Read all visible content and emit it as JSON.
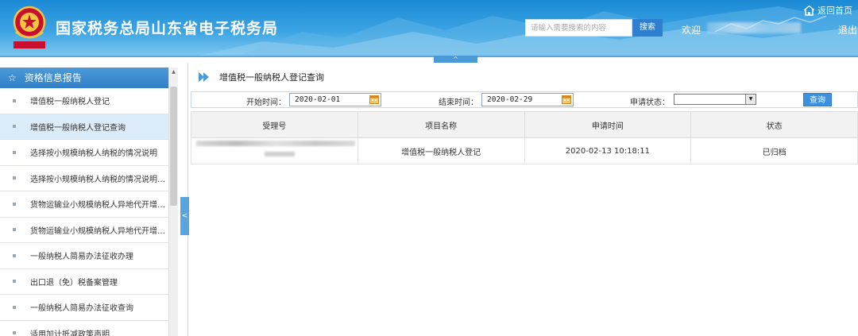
{
  "header": {
    "site_title": "国家税务总局山东省电子税务局",
    "search_placeholder": "请输入需要搜索的内容",
    "search_button": "搜索",
    "welcome": "欢迎",
    "home_link": "返回首页",
    "logout": "退出",
    "collapse_toggle": "^"
  },
  "sidebar": {
    "header_label": "资格信息报告",
    "header_icon": "star-icon",
    "items": [
      {
        "label": "增值税一般纳税人登记",
        "active": false
      },
      {
        "label": "增值税一般纳税人登记查询",
        "active": true
      },
      {
        "label": "选择按小规模纳税人纳税的情况说明",
        "active": false
      },
      {
        "label": "选择按小规模纳税人纳税的情况说明查...",
        "active": false
      },
      {
        "label": "货物运输业小规模纳税人异地代开增值...",
        "active": false
      },
      {
        "label": "货物运输业小规模纳税人异地代开增值...",
        "active": false
      },
      {
        "label": "一般纳税人简易办法征收办理",
        "active": false
      },
      {
        "label": "出口退（免）税备案管理",
        "active": false
      },
      {
        "label": "一般纳税人简易办法征收查询",
        "active": false
      },
      {
        "label": "适用加计抵减政策声明",
        "active": false
      }
    ],
    "collapse_toggle": "<"
  },
  "main": {
    "page_title": "增值税一般纳税人登记查询",
    "filters": {
      "start_label": "开始时间：",
      "start_value": "2020-02-01",
      "end_label": "结束时间：",
      "end_value": "2020-02-29",
      "status_label": "申请状态：",
      "status_value": "",
      "query_button": "查询"
    },
    "table": {
      "headers": [
        "受理号",
        "项目名称",
        "申请时间",
        "状态"
      ],
      "rows": [
        [
          "",
          "增值税一般纳税人登记",
          "2020-02-13 10:18:11",
          "已归档"
        ]
      ]
    }
  },
  "colors": {
    "header_blue": "#1b8ad4",
    "accent_blue": "#3d8fe0",
    "active_item": "#dcebf8"
  }
}
